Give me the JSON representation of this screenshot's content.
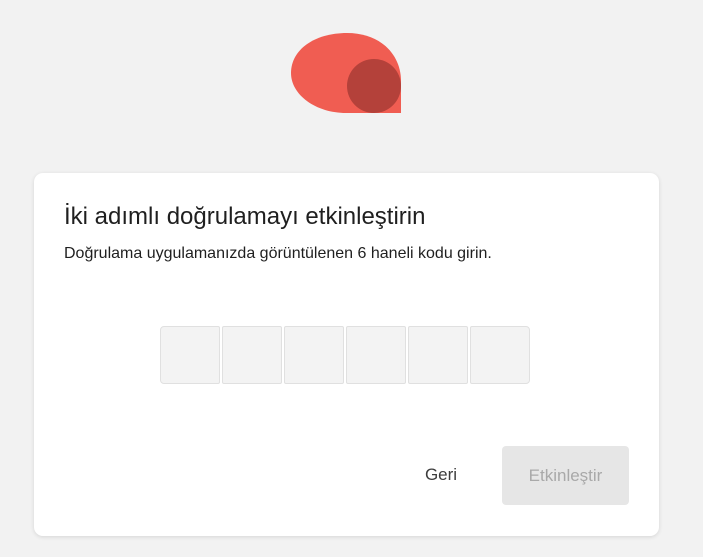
{
  "logo": {
    "icon": "brand-logo-icon",
    "color_primary": "#f05d52",
    "color_secondary": "#b4413a"
  },
  "card": {
    "title": "İki adımlı doğrulamayı etkinleştirin",
    "subtitle": "Doğrulama uygulamanızda görüntülenen 6 haneli kodu girin."
  },
  "code_inputs": [
    {
      "value": ""
    },
    {
      "value": ""
    },
    {
      "value": ""
    },
    {
      "value": ""
    },
    {
      "value": ""
    },
    {
      "value": ""
    }
  ],
  "actions": {
    "back_label": "Geri",
    "activate_label": "Etkinleştir",
    "activate_enabled": false
  }
}
